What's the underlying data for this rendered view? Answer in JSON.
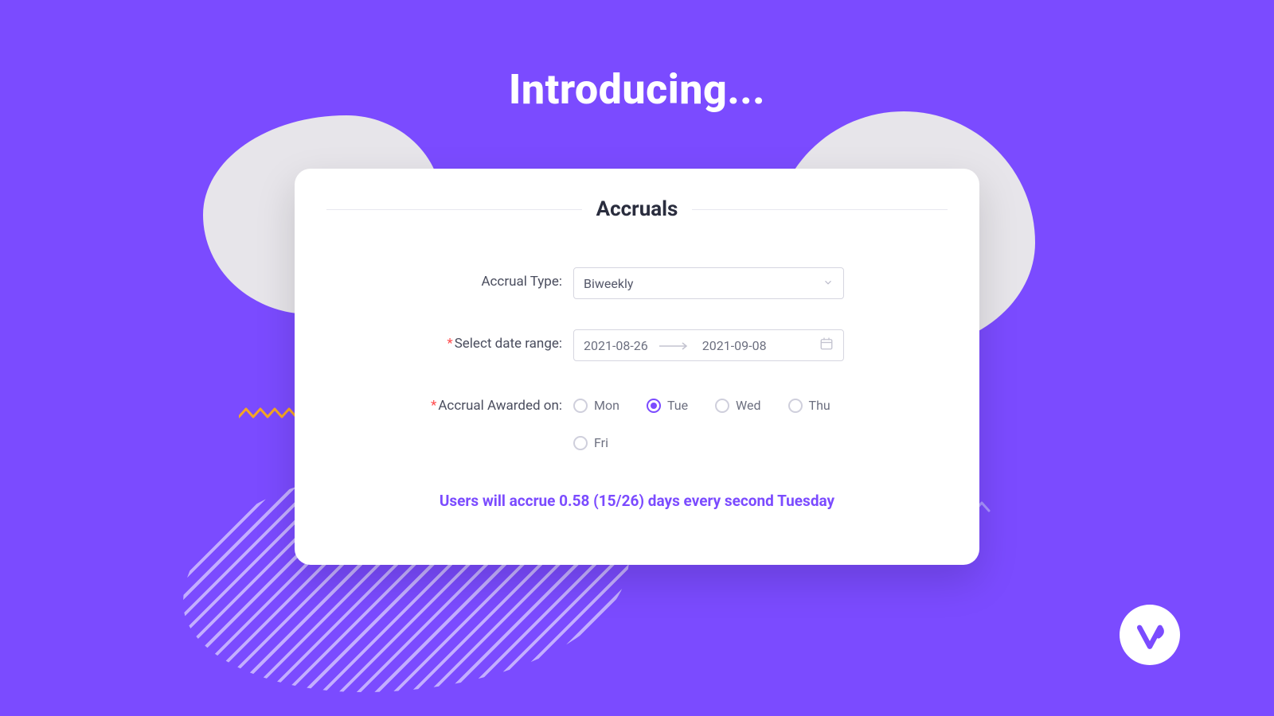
{
  "heading": "Introducing...",
  "card": {
    "title": "Accruals",
    "fields": {
      "accrual_type": {
        "label": "Accrual Type:",
        "value": "Biweekly"
      },
      "date_range": {
        "label": "Select date range:",
        "start": "2021-08-26",
        "end": "2021-09-08"
      },
      "awarded_on": {
        "label": "Accrual Awarded on:",
        "options": [
          "Mon",
          "Tue",
          "Wed",
          "Thu",
          "Fri"
        ],
        "selected": "Tue"
      }
    },
    "summary": "Users will accrue 0.58 (15/26) days every second Tuesday"
  },
  "colors": {
    "brand": "#7b4bff",
    "accent_yellow": "#f5a623"
  }
}
